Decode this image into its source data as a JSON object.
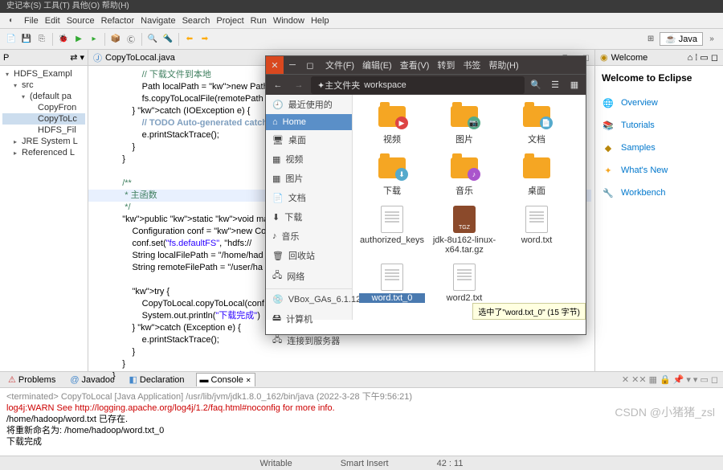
{
  "linuxTitle": "史记本(S) 工具(T) 具他(O) 帮助(H)",
  "menu": [
    "File",
    "Edit",
    "Source",
    "Refactor",
    "Navigate",
    "Search",
    "Project",
    "Run",
    "Window",
    "Help"
  ],
  "perspective": {
    "label": "Java"
  },
  "pkgExplorer": {
    "tab": "P",
    "items": [
      {
        "l": 1,
        "ic": "▾",
        "t": "HDFS_Exampl"
      },
      {
        "l": 2,
        "ic": "▾",
        "t": "src"
      },
      {
        "l": 3,
        "ic": "▾",
        "t": "(default pa"
      },
      {
        "l": 4,
        "ic": "",
        "t": "CopyFron"
      },
      {
        "l": 4,
        "ic": "",
        "t": "CopyToLc",
        "sel": true
      },
      {
        "l": 4,
        "ic": "",
        "t": "HDFS_Fil"
      },
      {
        "l": 2,
        "ic": "▸",
        "t": "JRE System L"
      },
      {
        "l": 2,
        "ic": "▸",
        "t": "Referenced L"
      }
    ]
  },
  "editor": {
    "tab": "CopyToLocal.java",
    "lines": [
      {
        "c": "            // 下载文件到本地",
        "cls": "cm"
      },
      {
        "c": "            Path localPath = new Path(loc",
        "cls": ""
      },
      {
        "c": "            fs.copyToLocalFile(remotePath",
        "cls": ""
      },
      {
        "c": "        } catch (IOException e) {",
        "cls": ""
      },
      {
        "c": "            // TODO Auto-generated catch",
        "cls": "todo"
      },
      {
        "c": "            e.printStackTrace();",
        "cls": ""
      },
      {
        "c": "        }",
        "cls": ""
      },
      {
        "c": "    }",
        "cls": ""
      },
      {
        "c": "",
        "cls": ""
      },
      {
        "c": "    /**",
        "cls": "cm"
      },
      {
        "c": "     * 主函数",
        "cls": "cm hl"
      },
      {
        "c": "     */",
        "cls": "cm"
      },
      {
        "c": "    public static void main(String[] args",
        "cls": ""
      },
      {
        "c": "        Configuration conf = new Configur",
        "cls": ""
      },
      {
        "c": "        conf.set(\"fs.defaultFS\", \"hdfs://",
        "cls": ""
      },
      {
        "c": "        String localFilePath = \"/home/had",
        "cls": ""
      },
      {
        "c": "        String remoteFilePath = \"/user/ha",
        "cls": ""
      },
      {
        "c": "",
        "cls": ""
      },
      {
        "c": "        try {",
        "cls": ""
      },
      {
        "c": "            CopyToLocal.copyToLocal(conf,",
        "cls": ""
      },
      {
        "c": "            System.out.println(\"下载完成\")",
        "cls": ""
      },
      {
        "c": "        } catch (Exception e) {",
        "cls": ""
      },
      {
        "c": "            e.printStackTrace();",
        "cls": ""
      },
      {
        "c": "        }",
        "cls": ""
      },
      {
        "c": "    }",
        "cls": ""
      },
      {
        "c": "}",
        "cls": ""
      }
    ]
  },
  "welcome": {
    "tab": "Welcome",
    "title": "Welcome to Eclipse",
    "links": [
      {
        "ic": "🌐",
        "c": "#f5a623",
        "t": "Overview"
      },
      {
        "ic": "📚",
        "c": "#4aa",
        "t": "Tutorials"
      },
      {
        "ic": "◆",
        "c": "#b8860b",
        "t": "Samples"
      },
      {
        "ic": "✦",
        "c": "#f5a623",
        "t": "What's New"
      },
      {
        "ic": "🔧",
        "c": "#888",
        "t": "Workbench"
      }
    ]
  },
  "console": {
    "tabs": [
      "Problems",
      "Javadoc",
      "Declaration",
      "Console"
    ],
    "header": "<terminated> CopyToLocal [Java Application] /usr/lib/jvm/jdk1.8.0_162/bin/java (2022-3-28 下午9:56:21)",
    "lines": [
      {
        "t": "log4j:WARN See http://logging.apache.org/log4j/1.2/faq.html#noconfig for more info.",
        "red": true
      },
      {
        "t": "/home/hadoop/word.txt 已存在.",
        "red": false
      },
      {
        "t": "将重新命名为: /home/hadoop/word.txt_0",
        "red": false
      },
      {
        "t": "下载完成",
        "red": false
      }
    ]
  },
  "status": {
    "writable": "Writable",
    "insert": "Smart Insert",
    "pos": "42 : 11"
  },
  "fm": {
    "menu": [
      "文件(F)",
      "编辑(E)",
      "查看(V)",
      "转到",
      "书签",
      "帮助(H)",
      ""
    ],
    "bc": {
      "home": "✦主文件夹",
      "path": "workspace"
    },
    "side": [
      {
        "t": "最近使用的",
        "ic": "🕘"
      },
      {
        "t": "Home",
        "ic": "⌂",
        "act": true
      },
      {
        "t": "桌面",
        "ic": "🖥"
      },
      {
        "t": "视频",
        "ic": "▦"
      },
      {
        "t": "图片",
        "ic": "▦"
      },
      {
        "t": "文档",
        "ic": "📄"
      },
      {
        "t": "下载",
        "ic": "⬇"
      },
      {
        "t": "音乐",
        "ic": "♪"
      },
      {
        "t": "回收站",
        "ic": "🗑"
      },
      {
        "t": "网络",
        "ic": "🖧"
      },
      {
        "sep": true
      },
      {
        "t": "VBox_GAs_6.1.12",
        "ic": "💿",
        "eject": "▲"
      },
      {
        "t": "计算机",
        "ic": "🖴"
      },
      {
        "t": "连接到服务器",
        "ic": "🖧"
      }
    ],
    "files": [
      {
        "t": "视频",
        "type": "folder",
        "ov": "▶",
        "ovc": "#d44"
      },
      {
        "t": "图片",
        "type": "folder",
        "ov": "📷",
        "ovc": "#5a8"
      },
      {
        "t": "文档",
        "type": "folder",
        "ov": "📄",
        "ovc": "#5ac"
      },
      {
        "t": "下载",
        "type": "folder",
        "ov": "⬇",
        "ovc": "#5ac"
      },
      {
        "t": "音乐",
        "type": "folder",
        "ov": "♪",
        "ovc": "#a5c"
      },
      {
        "t": "桌面",
        "type": "folder",
        "ov": "",
        "ovc": ""
      },
      {
        "t": "authorized_keys",
        "type": "doc"
      },
      {
        "t": "jdk-8u162-linux-x64.tar.gz",
        "type": "tgz"
      },
      {
        "t": "word.txt",
        "type": "doc"
      },
      {
        "t": "word.txt_0",
        "type": "doc",
        "sel": true
      },
      {
        "t": "word2.txt",
        "type": "doc"
      }
    ],
    "statusbar": "选中了\"word.txt_0\" (15 字节)"
  },
  "watermark": "CSDN @小猪猪_zsl"
}
